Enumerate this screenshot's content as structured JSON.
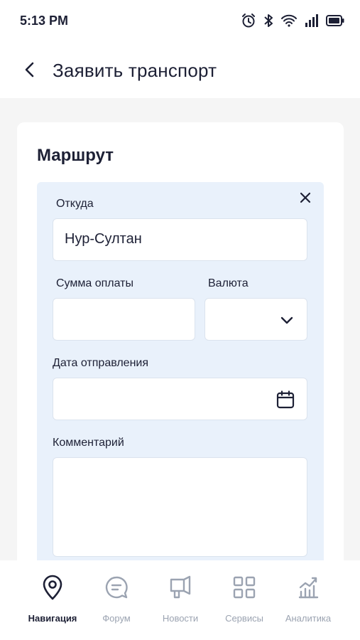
{
  "status_bar": {
    "time": "5:13 PM",
    "icons": [
      "alarm-icon",
      "bluetooth-icon",
      "wifi-icon",
      "signal-icon",
      "battery-icon"
    ]
  },
  "header": {
    "back_icon": "chevron-left-icon",
    "title": "Заявить транспорт"
  },
  "route": {
    "section_title": "Маршрут",
    "close_icon": "close-icon",
    "from": {
      "label": "Откуда",
      "value": "Нур-Султан"
    },
    "amount": {
      "label": "Сумма оплаты",
      "value": ""
    },
    "currency": {
      "label": "Валюта",
      "value": "",
      "icon": "chevron-down-icon"
    },
    "departure_date": {
      "label": "Дата отправления",
      "value": "",
      "icon": "calendar-icon"
    },
    "comment": {
      "label": "Комментарий",
      "value": ""
    }
  },
  "bottom_nav": {
    "active": "Навигация",
    "items": [
      {
        "label": "Навигация",
        "icon": "map-pin-icon"
      },
      {
        "label": "Форум",
        "icon": "chat-icon"
      },
      {
        "label": "Новости",
        "icon": "megaphone-icon"
      },
      {
        "label": "Сервисы",
        "icon": "grid-icon"
      },
      {
        "label": "Аналитика",
        "icon": "chart-icon"
      }
    ]
  },
  "colors": {
    "text_primary": "#1d2035",
    "text_inactive": "#9ba3b1",
    "route_box_bg": "#e9f1fb",
    "page_bg": "#f5f5f5",
    "card_bg": "#ffffff"
  }
}
